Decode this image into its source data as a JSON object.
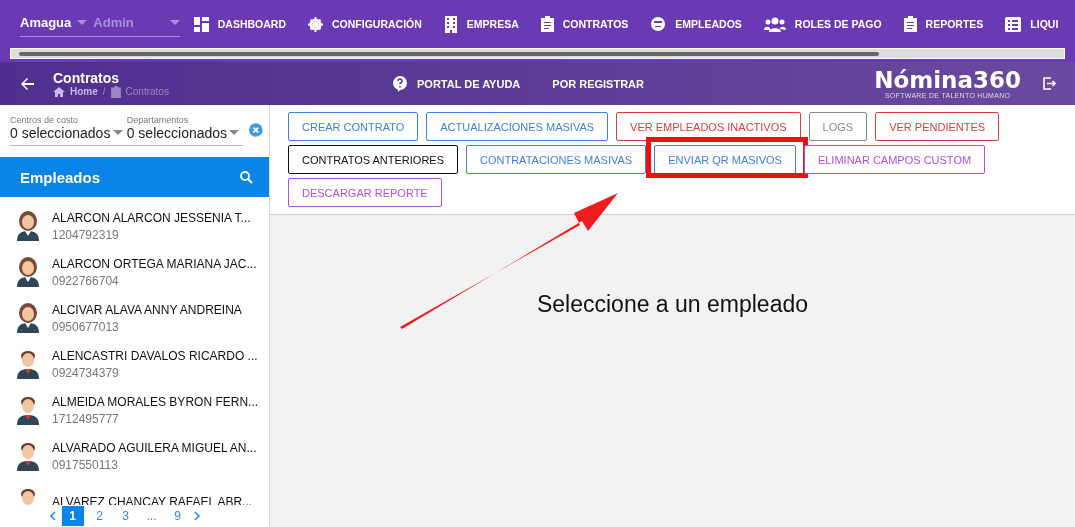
{
  "company": {
    "value": "Amagua"
  },
  "role": {
    "value": "Admin"
  },
  "nav": [
    {
      "label": "DASHBOARD"
    },
    {
      "label": "CONFIGURACIÓN"
    },
    {
      "label": "EMPRESA"
    },
    {
      "label": "CONTRATOS"
    },
    {
      "label": "EMPLEADOS"
    },
    {
      "label": "ROLES DE PAGO"
    },
    {
      "label": "REPORTES"
    },
    {
      "label": "LIQUI"
    }
  ],
  "page": {
    "title": "Contratos",
    "breadcrumb": [
      "Home",
      "Contratos"
    ],
    "separator": "/"
  },
  "header_links": [
    {
      "label": "PORTAL DE AYUDA"
    },
    {
      "label": "POR REGISTRAR"
    }
  ],
  "logo": {
    "name": "Nómina360",
    "tagline": "SOFTWARE DE TALENTO HUMANO"
  },
  "filters": [
    {
      "label": "Centros de costo",
      "value": "0 seleccionados"
    },
    {
      "label": "Departamentos",
      "value": "0 seleccionados"
    }
  ],
  "employees_title": "Empleados",
  "employees": [
    {
      "name": "ALARCON ALARCON JESSENIA T...",
      "id": "1204792319",
      "kind": "female"
    },
    {
      "name": "ALARCON ORTEGA MARIANA JAC...",
      "id": "0922766704",
      "kind": "female"
    },
    {
      "name": "ALCIVAR ALAVA ANNY ANDREINA",
      "id": "0950677013",
      "kind": "female"
    },
    {
      "name": "ALENCASTRI DAVALOS RICARDO ...",
      "id": "0924734379",
      "kind": "male"
    },
    {
      "name": "ALMEIDA MORALES BYRON FERN...",
      "id": "1712495777",
      "kind": "male"
    },
    {
      "name": "ALVARADO AGUILERA MIGUEL AN...",
      "id": "0917550113",
      "kind": "male"
    },
    {
      "name": "ALVAREZ CHANCAY RAFAEL ABR...",
      "kind": "male"
    }
  ],
  "pagination": [
    {
      "label": "1",
      "selected": true
    },
    {
      "label": "2",
      "selected": false
    },
    {
      "label": "3",
      "selected": false
    },
    {
      "label": "...",
      "selected": false
    },
    {
      "label": "9",
      "selected": false
    }
  ],
  "actions": [
    {
      "label": "CREAR CONTRATO",
      "kind": "blue",
      "highlighted": false
    },
    {
      "label": "ACTUALIZACIONES MASIVAS",
      "kind": "blue",
      "highlighted": false
    },
    {
      "label": "VER EMPLEADOS INACTIVOS",
      "kind": "red",
      "highlighted": false
    },
    {
      "label": "LOGS",
      "kind": "grey",
      "highlighted": false
    },
    {
      "label": "VER PENDIENTES",
      "kind": "red",
      "highlighted": false
    },
    {
      "label": "CONTRATOS ANTERIORES",
      "kind": "black",
      "highlighted": false
    },
    {
      "label": "CONTRATACIONES MASIVAS",
      "kind": "blue",
      "highlighted": false
    },
    {
      "label": "ENVIAR QR MASIVOS",
      "kind": "blue",
      "highlighted": true
    },
    {
      "label": "ELIMINAR CAMPOS CUSTOM",
      "kind": "purple",
      "highlighted": false
    },
    {
      "label": "DESCARGAR REPORTE",
      "kind": "purple",
      "highlighted": false
    }
  ],
  "empty_message": "Seleccione a un empleado"
}
